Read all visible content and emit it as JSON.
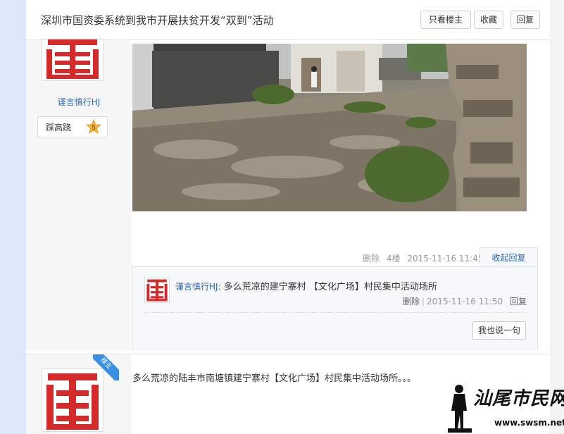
{
  "header": {
    "title": "深圳市国资委系统到我市开展扶贫开发“双到”活动",
    "buttons": {
      "only_op": "只看楼主",
      "favorite": "收藏",
      "reply": "回复"
    }
  },
  "post": {
    "author": {
      "name": "谨言慎行HJ",
      "level_name": "踩高跷",
      "level_number": "5"
    },
    "meta": {
      "delete": "删除",
      "floor": "4楼",
      "time": "2015-11-16 11:45",
      "collapse_reply": "收起回复"
    },
    "reply": {
      "author": "谨言慎行HJ:",
      "text": "多么荒凉的建宁寨村 【文化广场】村民集中活动场所",
      "delete": "删除",
      "time": "2015-11-16 11:50",
      "reply": "回复",
      "say_button": "我也说一句"
    }
  },
  "post2": {
    "op_badge": "楼主",
    "text": "多么荒凉的陆丰市南塘镇建宁寨村【文化广场】村民集中活动场所。。。"
  },
  "watermark": {
    "cn": "汕尾市民网",
    "url": "www.swsm.net"
  },
  "colors": {
    "link_blue": "#2d64b3",
    "avatar_red": "#d42a2a",
    "op_badge_blue": "#3a8fe0",
    "level_star": "#f3b33a"
  }
}
